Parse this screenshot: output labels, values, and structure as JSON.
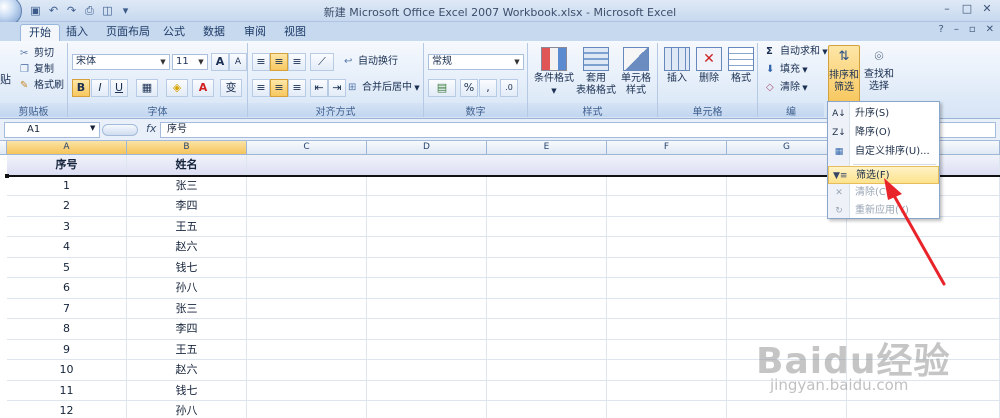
{
  "window": {
    "title": "新建 Microsoft Office Excel 2007 Workbook.xlsx - Microsoft Excel"
  },
  "tabs": [
    "开始",
    "插入",
    "页面布局",
    "公式",
    "数据",
    "审阅",
    "视图"
  ],
  "ribbon": {
    "clipboard": {
      "paste": "贴",
      "cut": "剪切",
      "copy": "复制",
      "format_painter": "格式刷",
      "label": "剪贴板"
    },
    "font": {
      "name": "宋体",
      "size": "11",
      "bold": "B",
      "italic": "I",
      "underline": "U",
      "grow": "A",
      "shrink": "A",
      "label": "字体",
      "phonetic": "变"
    },
    "alignment": {
      "wrap": "自动换行",
      "merge": "合并后居中",
      "label": "对齐方式"
    },
    "number": {
      "format": "常规",
      "percent": "%",
      "comma": ",",
      "label": "数字"
    },
    "styles": {
      "conditional": "条件格式",
      "table_line1": "套用",
      "table_line2": "表格格式",
      "cell_line1": "单元格",
      "cell_line2": "样式",
      "label": "样式"
    },
    "cells": {
      "insert": "插入",
      "delete": "删除",
      "format": "格式",
      "label": "单元格"
    },
    "editing": {
      "autosum": "自动求和",
      "fill": "填充",
      "clear": "清除",
      "sort_line1": "排序和",
      "sort_line2": "筛选",
      "find_line1": "查找和",
      "find_line2": "选择",
      "label": "编"
    }
  },
  "formula_bar": {
    "name_box": "A1",
    "fx": "fx",
    "content": "序号"
  },
  "columns": [
    "A",
    "B",
    "C",
    "D",
    "E",
    "F",
    "G"
  ],
  "table": {
    "headers": [
      "序号",
      "姓名"
    ],
    "rows": [
      [
        "1",
        "张三"
      ],
      [
        "2",
        "李四"
      ],
      [
        "3",
        "王五"
      ],
      [
        "4",
        "赵六"
      ],
      [
        "5",
        "钱七"
      ],
      [
        "6",
        "孙八"
      ],
      [
        "7",
        "张三"
      ],
      [
        "8",
        "李四"
      ],
      [
        "9",
        "王五"
      ],
      [
        "10",
        "赵六"
      ],
      [
        "11",
        "钱七"
      ],
      [
        "12",
        "孙八"
      ]
    ]
  },
  "sort_menu": {
    "items": [
      {
        "label": "升序(S)",
        "icon": "sort-ascending-icon",
        "enabled": true
      },
      {
        "label": "降序(O)",
        "icon": "sort-descending-icon",
        "enabled": true
      },
      {
        "label": "自定义排序(U)...",
        "icon": "custom-sort-icon",
        "enabled": true
      },
      {
        "label": "筛选(F)",
        "icon": "filter-icon",
        "enabled": true,
        "highlighted": true
      },
      {
        "label": "清除(C)",
        "icon": "clear-filter-icon",
        "enabled": false
      },
      {
        "label": "重新应用(Y)",
        "icon": "reapply-icon",
        "enabled": false
      }
    ]
  },
  "watermark": {
    "brand": "Baidu经验",
    "url": "jingyan.baidu.com"
  },
  "colors": {
    "annotation_arrow": "#e8232a",
    "highlight": "#fde38c",
    "ribbon_bg": "#e3edf9"
  }
}
